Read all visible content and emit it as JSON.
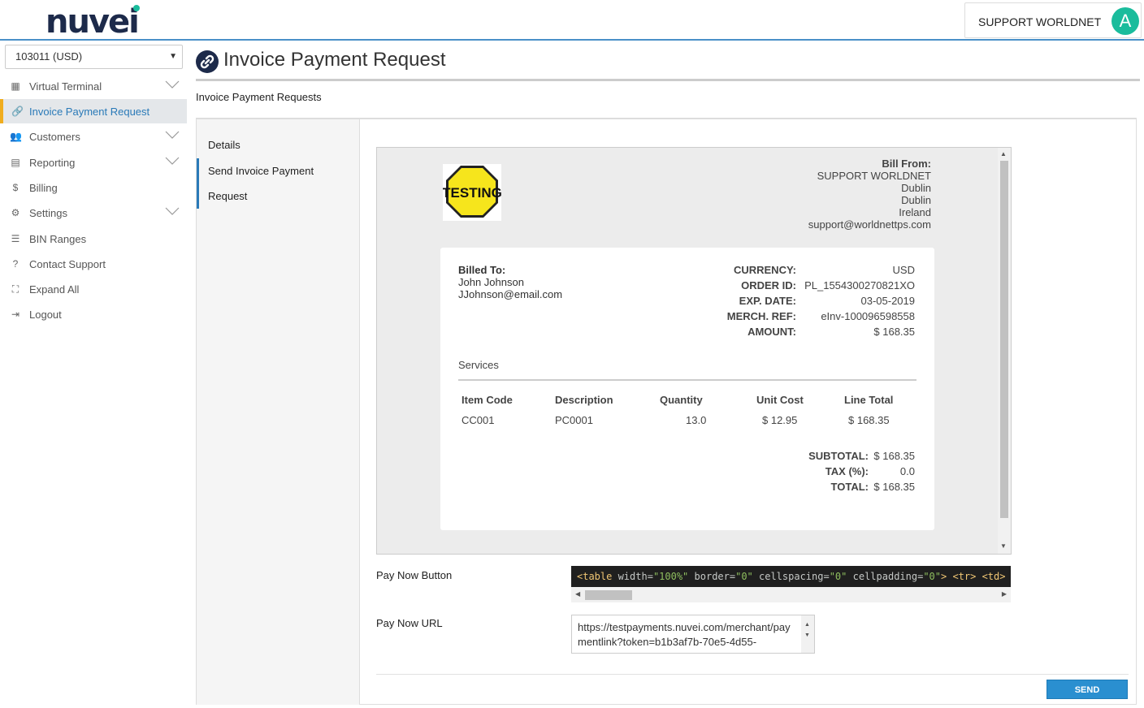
{
  "brand": {
    "logo_text": "nuvei",
    "accent": "#1abc9c",
    "primary": "#2a7ab8"
  },
  "user": {
    "name": "SUPPORT WORLDNET",
    "avatar_letter": "A"
  },
  "account_select": {
    "value": "103011 (USD)"
  },
  "sidebar": {
    "items": [
      {
        "label": "Virtual Terminal",
        "icon": "calculator-icon",
        "expandable": true
      },
      {
        "label": "Invoice Payment Request",
        "icon": "link-icon",
        "active": true
      },
      {
        "label": "Customers",
        "icon": "users-icon",
        "expandable": true
      },
      {
        "label": "Reporting",
        "icon": "file-icon",
        "expandable": true
      },
      {
        "label": "Billing",
        "icon": "dollar-icon"
      },
      {
        "label": "Settings",
        "icon": "gears-icon",
        "expandable": true
      },
      {
        "label": "BIN Ranges",
        "icon": "list-icon"
      },
      {
        "label": "Contact Support",
        "icon": "question-icon"
      },
      {
        "label": "Expand All",
        "icon": "expand-icon"
      },
      {
        "label": "Logout",
        "icon": "logout-icon"
      }
    ]
  },
  "page": {
    "title": "Invoice Payment Request",
    "subtitle": "Invoice Payment Requests"
  },
  "tabs": {
    "details": "Details",
    "send_line1": "Send Invoice Payment",
    "send_line2": "Request"
  },
  "invoice": {
    "logo_text": "TESTING",
    "bill_from": {
      "heading": "Bill From:",
      "lines": [
        "SUPPORT WORLDNET",
        "Dublin",
        "Dublin",
        "Ireland",
        "support@worldnettps.com"
      ]
    },
    "billed_to": {
      "heading": "Billed To:",
      "name": "John Johnson",
      "email": "JJohnson@email.com"
    },
    "meta": [
      {
        "key": "CURRENCY:",
        "value": "USD"
      },
      {
        "key": "ORDER ID:",
        "value": "PL_1554300270821XO"
      },
      {
        "key": "EXP. DATE:",
        "value": "03-05-2019"
      },
      {
        "key": "MERCH. REF:",
        "value": "eInv-100096598558"
      },
      {
        "key": "AMOUNT:",
        "value": "$ 168.35"
      }
    ],
    "services_label": "Services",
    "columns": [
      "Item Code",
      "Description",
      "Quantity",
      "Unit Cost",
      "Line Total"
    ],
    "rows": [
      [
        "CC001",
        "PC0001",
        "13.0",
        "$ 12.95",
        "$ 168.35"
      ]
    ],
    "totals": [
      {
        "key": "SUBTOTAL:",
        "value": "$ 168.35"
      },
      {
        "key": "TAX (%):",
        "value": "0.0"
      },
      {
        "key": "TOTAL:",
        "value": "$ 168.35"
      }
    ]
  },
  "pay_now_button": {
    "label": "Pay Now Button",
    "code_tokens": [
      {
        "t": "tg",
        "v": "<table"
      },
      {
        "t": "at",
        "v": " width="
      },
      {
        "t": "st",
        "v": "\"100%\""
      },
      {
        "t": "at",
        "v": " border="
      },
      {
        "t": "st",
        "v": "\"0\""
      },
      {
        "t": "at",
        "v": " cellspacing="
      },
      {
        "t": "st",
        "v": "\"0\""
      },
      {
        "t": "at",
        "v": " cellpadding="
      },
      {
        "t": "st",
        "v": "\"0\""
      },
      {
        "t": "tg",
        "v": "> <tr> <td>"
      }
    ]
  },
  "pay_now_url": {
    "label": "Pay Now URL",
    "value": "https://testpayments.nuvei.com/merchant/paymentlink?token=b1b3af7b-70e5-4d55-"
  },
  "send_button": {
    "label": "SEND"
  }
}
